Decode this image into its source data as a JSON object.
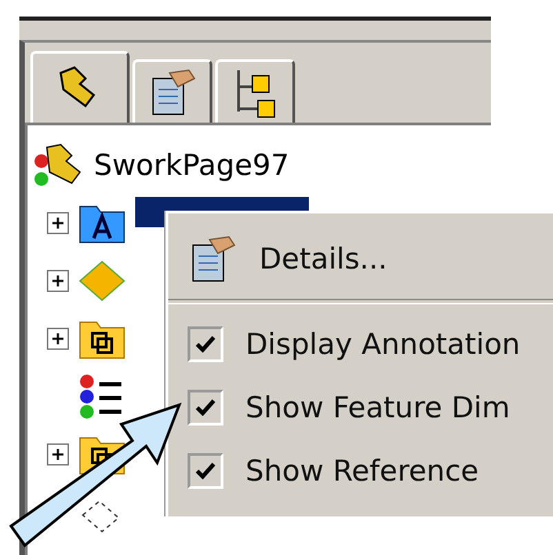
{
  "tabs": [
    {
      "kind": "assembly",
      "selected": true
    },
    {
      "kind": "properties",
      "selected": false
    },
    {
      "kind": "configurations",
      "selected": false
    }
  ],
  "tree": {
    "label": "SworkPage97",
    "kind": "assembly",
    "children": [
      {
        "kind": "annotations",
        "expandable": true,
        "selected": true
      },
      {
        "kind": "plane",
        "expandable": true,
        "selected": false
      },
      {
        "kind": "folder",
        "expandable": true,
        "selected": false
      },
      {
        "kind": "lights",
        "expandable": false,
        "selected": false
      },
      {
        "kind": "folder",
        "expandable": true,
        "selected": false
      },
      {
        "kind": "sketch",
        "expandable": false,
        "selected": false
      }
    ]
  },
  "context_menu": {
    "items": [
      {
        "kind": "command",
        "label": "Details..."
      },
      {
        "kind": "separator"
      },
      {
        "kind": "check",
        "label": "Display Annotation",
        "checked": true
      },
      {
        "kind": "check",
        "label": "Show Feature Dim",
        "checked": true
      },
      {
        "kind": "check",
        "label": "Show Reference",
        "checked": true
      }
    ]
  }
}
